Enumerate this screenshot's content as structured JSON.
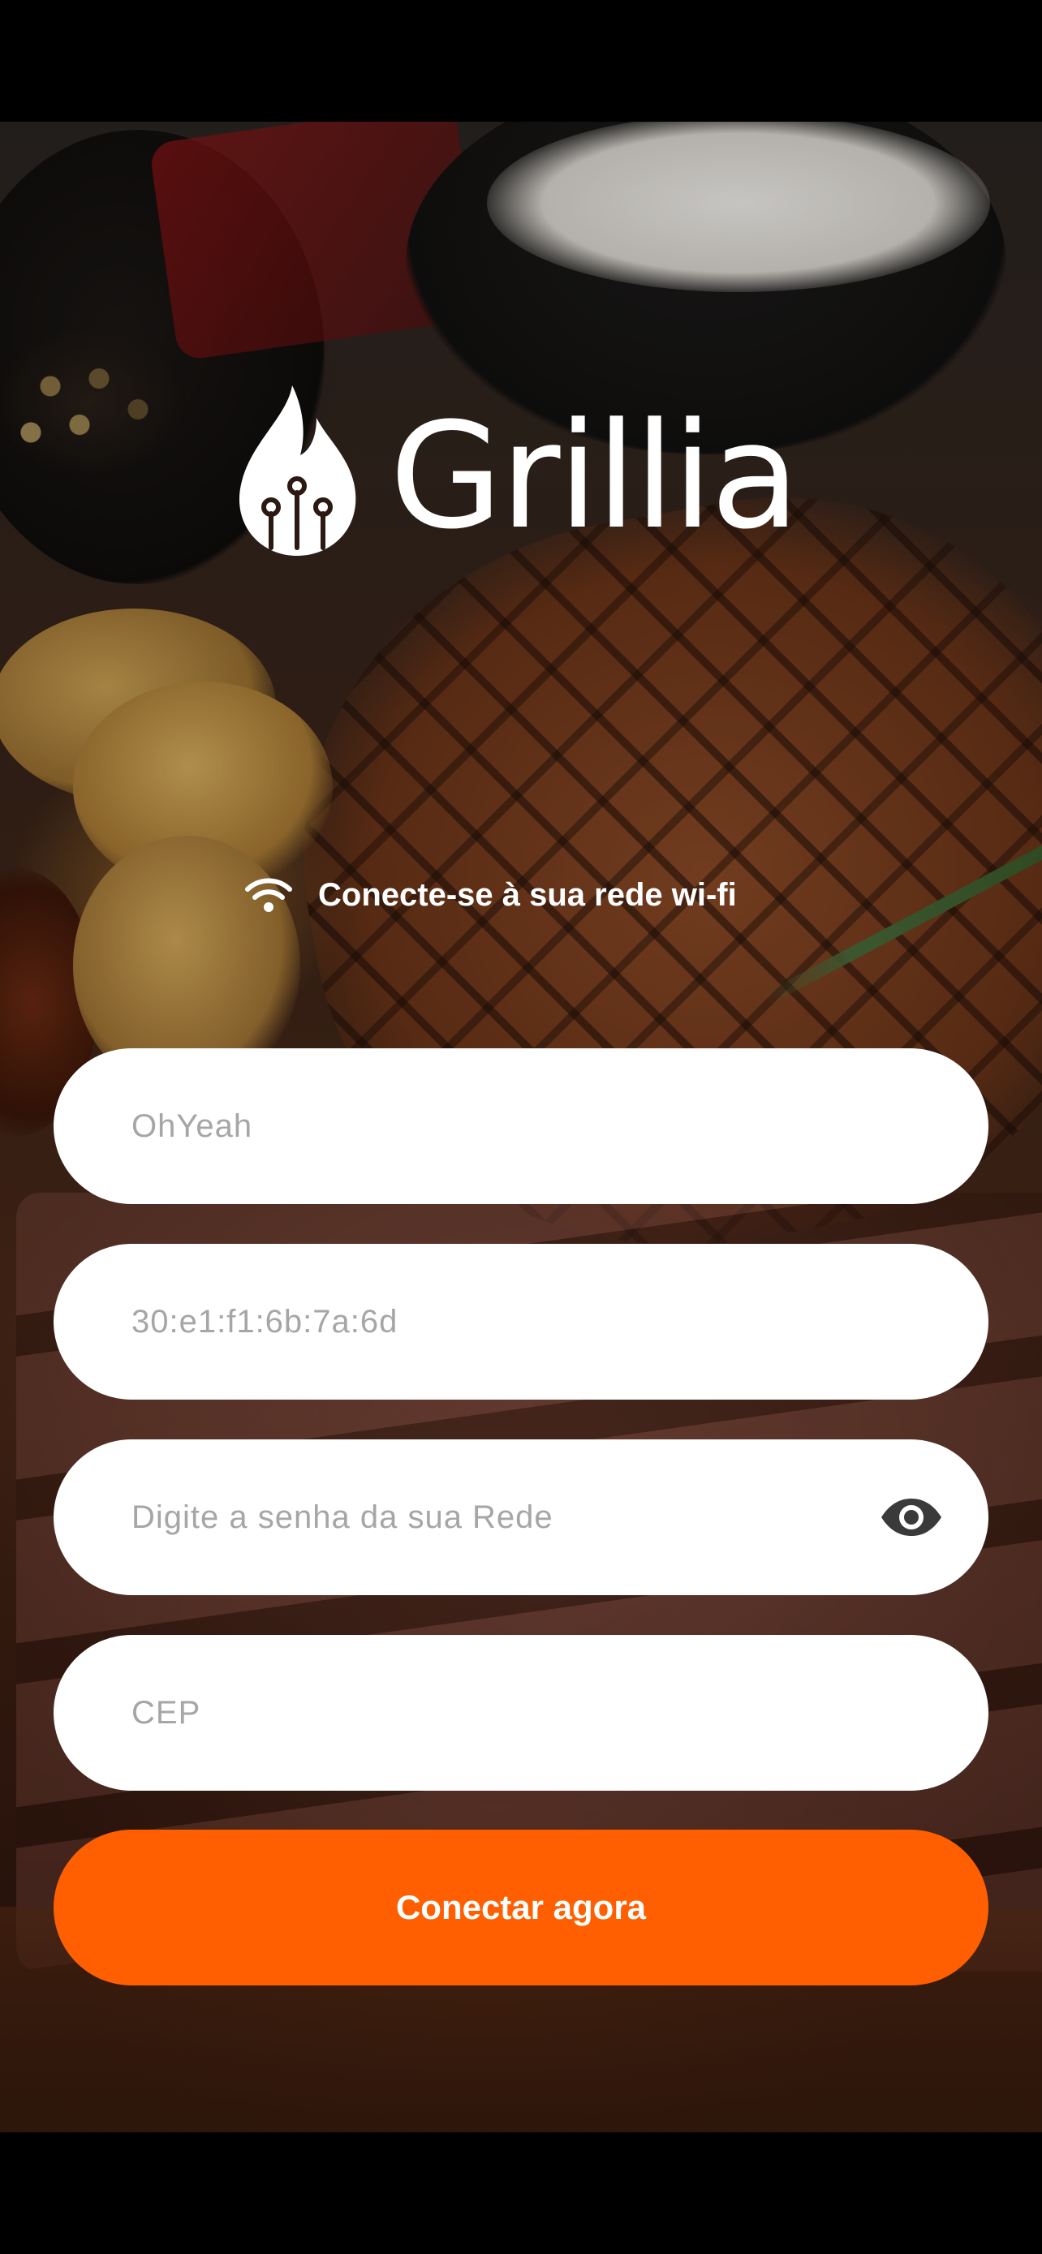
{
  "app": {
    "name": "Grillia"
  },
  "wifi_prompt": {
    "text": "Conecte-se à sua rede wi-fi",
    "icon": "wifi-icon"
  },
  "form": {
    "network_name": {
      "placeholder": "OhYeah",
      "value": ""
    },
    "mac_address": {
      "placeholder": "30:e1:f1:6b:7a:6d",
      "value": ""
    },
    "password": {
      "placeholder": "Digite a senha da sua Rede",
      "value": "",
      "toggle_icon": "eye-icon"
    },
    "cep": {
      "placeholder": "CEP",
      "value": ""
    }
  },
  "submit": {
    "label": "Conectar agora"
  },
  "colors": {
    "accent": "#ff5f00",
    "field_background": "#ffffff",
    "placeholder": "#a6a6a6"
  }
}
